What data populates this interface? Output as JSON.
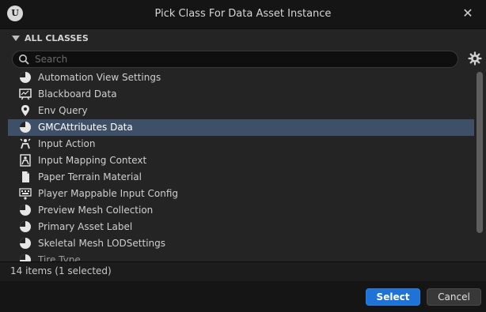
{
  "window": {
    "title": "Pick Class For Data Asset Instance",
    "logo_text": "U",
    "close_glyph": "✕"
  },
  "section": {
    "label": "ALL CLASSES"
  },
  "search": {
    "placeholder": "Search",
    "value": ""
  },
  "items": [
    {
      "label": "Automation View Settings",
      "icon": "pie-icon"
    },
    {
      "label": "Blackboard Data",
      "icon": "blackboard-icon"
    },
    {
      "label": "Env Query",
      "icon": "pin-icon"
    },
    {
      "label": "GMCAttributes Data",
      "icon": "pie-icon",
      "selected": true
    },
    {
      "label": "Input Action",
      "icon": "input-action-icon"
    },
    {
      "label": "Input Mapping Context",
      "icon": "input-mapping-icon"
    },
    {
      "label": "Paper Terrain Material",
      "icon": "paper-icon"
    },
    {
      "label": "Player Mappable Input Config",
      "icon": "keyboard-icon"
    },
    {
      "label": "Preview Mesh Collection",
      "icon": "pie-icon"
    },
    {
      "label": "Primary Asset Label",
      "icon": "pie-icon"
    },
    {
      "label": "Skeletal Mesh LODSettings",
      "icon": "pie-icon"
    },
    {
      "label": "Tire Type",
      "icon": "pie-icon"
    }
  ],
  "status": {
    "text": "14 items (1 selected)"
  },
  "buttons": {
    "select": "Select",
    "cancel": "Cancel"
  },
  "colors": {
    "selection": "#3e5067",
    "accent": "#1f73d6",
    "background": "#242424"
  }
}
